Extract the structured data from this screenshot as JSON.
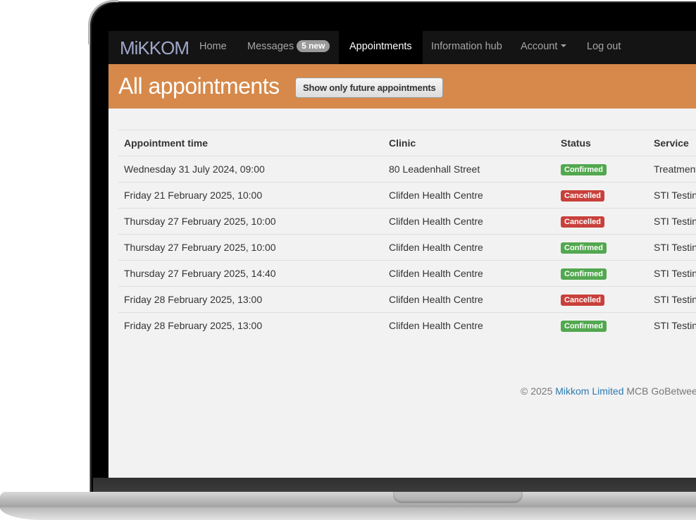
{
  "nav": {
    "brand": "MiKKOM",
    "items": [
      {
        "label": "Home"
      },
      {
        "label": "Messages",
        "badge": "5 new"
      },
      {
        "label": "Appointments"
      },
      {
        "label": "Information hub"
      },
      {
        "label": "Account"
      },
      {
        "label": "Log out"
      }
    ]
  },
  "header": {
    "title": "All appointments",
    "button": "Show only future appointments"
  },
  "table": {
    "headers": [
      "Appointment time",
      "Clinic",
      "Status",
      "Service"
    ],
    "rows": [
      {
        "time": "Wednesday 31 July 2024, 09:00",
        "clinic": "80 Leadenhall Street",
        "status": "Confirmed",
        "service": "Treatment"
      },
      {
        "time": "Friday 21 February 2025, 10:00",
        "clinic": "Clifden Health Centre",
        "status": "Cancelled",
        "service": "STI Testing"
      },
      {
        "time": "Thursday 27 February 2025, 10:00",
        "clinic": "Clifden Health Centre",
        "status": "Cancelled",
        "service": "STI Testing"
      },
      {
        "time": "Thursday 27 February 2025, 10:00",
        "clinic": "Clifden Health Centre",
        "status": "Confirmed",
        "service": "STI Testing"
      },
      {
        "time": "Thursday 27 February 2025, 14:40",
        "clinic": "Clifden Health Centre",
        "status": "Confirmed",
        "service": "STI Testing"
      },
      {
        "time": "Friday 28 February 2025, 13:00",
        "clinic": "Clifden Health Centre",
        "status": "Cancelled",
        "service": "STI Testing"
      },
      {
        "time": "Friday 28 February 2025, 13:00",
        "clinic": "Clifden Health Centre",
        "status": "Confirmed",
        "service": "STI Testing"
      }
    ]
  },
  "footer": {
    "copyright": "© 2025",
    "company": "Mikkom Limited",
    "product": "MCB GoBetween"
  },
  "colors": {
    "header_band": "#d6894a",
    "confirmed": "#52a84f",
    "cancelled": "#c9403a",
    "navbar": "#141414"
  }
}
